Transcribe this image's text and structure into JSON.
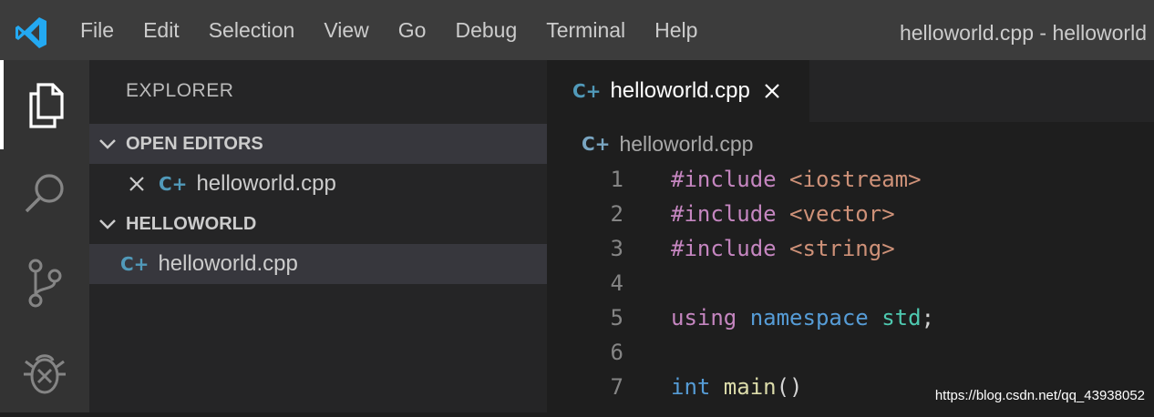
{
  "menu": [
    "File",
    "Edit",
    "Selection",
    "View",
    "Go",
    "Debug",
    "Terminal",
    "Help"
  ],
  "window_title": "helloworld.cpp - helloworld",
  "activity_bar": [
    "explorer-icon",
    "search-icon",
    "source-control-icon",
    "debug-icon"
  ],
  "sidebar": {
    "title": "EXPLORER",
    "open_editors": {
      "header": "OPEN EDITORS",
      "file": "helloworld.cpp"
    },
    "folder": {
      "header": "HELLOWORLD",
      "file": "helloworld.cpp"
    }
  },
  "editor": {
    "tab": "helloworld.cpp",
    "breadcrumb": "helloworld.cpp",
    "lines": [
      {
        "n": "1",
        "parts": [
          [
            "#include ",
            "kw-pre"
          ],
          [
            "<iostream>",
            "str"
          ]
        ]
      },
      {
        "n": "2",
        "parts": [
          [
            "#include ",
            "kw-pre"
          ],
          [
            "<vector>",
            "str"
          ]
        ]
      },
      {
        "n": "3",
        "parts": [
          [
            "#include ",
            "kw-pre"
          ],
          [
            "<string>",
            "str"
          ]
        ]
      },
      {
        "n": "4",
        "parts": []
      },
      {
        "n": "5",
        "parts": [
          [
            "using ",
            "kw-pre"
          ],
          [
            "namespace ",
            "kw"
          ],
          [
            "std",
            "ns"
          ],
          [
            ";",
            "punc"
          ]
        ]
      },
      {
        "n": "6",
        "parts": []
      },
      {
        "n": "7",
        "parts": [
          [
            "int ",
            "kw"
          ],
          [
            "main",
            "fn"
          ],
          [
            "()",
            "punc"
          ]
        ]
      }
    ]
  },
  "watermark": "https://blog.csdn.net/qq_43938052",
  "colors": {
    "titlebar": "#3c3c3c",
    "activitybar": "#333333",
    "sidebar": "#252526",
    "editor": "#1e1e1e",
    "selection": "#37373d",
    "vscode_blue": "#0a84d6"
  }
}
